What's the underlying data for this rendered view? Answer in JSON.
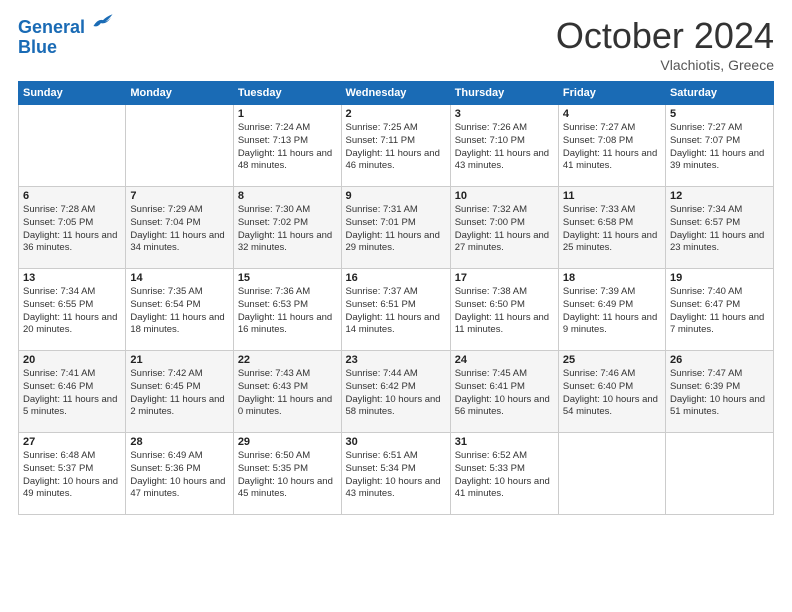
{
  "header": {
    "logo_line1": "General",
    "logo_line2": "Blue",
    "month": "October 2024",
    "location": "Vlachiotis, Greece"
  },
  "days_of_week": [
    "Sunday",
    "Monday",
    "Tuesday",
    "Wednesday",
    "Thursday",
    "Friday",
    "Saturday"
  ],
  "weeks": [
    [
      {
        "day": "",
        "info": ""
      },
      {
        "day": "",
        "info": ""
      },
      {
        "day": "1",
        "info": "Sunrise: 7:24 AM\nSunset: 7:13 PM\nDaylight: 11 hours and 48 minutes."
      },
      {
        "day": "2",
        "info": "Sunrise: 7:25 AM\nSunset: 7:11 PM\nDaylight: 11 hours and 46 minutes."
      },
      {
        "day": "3",
        "info": "Sunrise: 7:26 AM\nSunset: 7:10 PM\nDaylight: 11 hours and 43 minutes."
      },
      {
        "day": "4",
        "info": "Sunrise: 7:27 AM\nSunset: 7:08 PM\nDaylight: 11 hours and 41 minutes."
      },
      {
        "day": "5",
        "info": "Sunrise: 7:27 AM\nSunset: 7:07 PM\nDaylight: 11 hours and 39 minutes."
      }
    ],
    [
      {
        "day": "6",
        "info": "Sunrise: 7:28 AM\nSunset: 7:05 PM\nDaylight: 11 hours and 36 minutes."
      },
      {
        "day": "7",
        "info": "Sunrise: 7:29 AM\nSunset: 7:04 PM\nDaylight: 11 hours and 34 minutes."
      },
      {
        "day": "8",
        "info": "Sunrise: 7:30 AM\nSunset: 7:02 PM\nDaylight: 11 hours and 32 minutes."
      },
      {
        "day": "9",
        "info": "Sunrise: 7:31 AM\nSunset: 7:01 PM\nDaylight: 11 hours and 29 minutes."
      },
      {
        "day": "10",
        "info": "Sunrise: 7:32 AM\nSunset: 7:00 PM\nDaylight: 11 hours and 27 minutes."
      },
      {
        "day": "11",
        "info": "Sunrise: 7:33 AM\nSunset: 6:58 PM\nDaylight: 11 hours and 25 minutes."
      },
      {
        "day": "12",
        "info": "Sunrise: 7:34 AM\nSunset: 6:57 PM\nDaylight: 11 hours and 23 minutes."
      }
    ],
    [
      {
        "day": "13",
        "info": "Sunrise: 7:34 AM\nSunset: 6:55 PM\nDaylight: 11 hours and 20 minutes."
      },
      {
        "day": "14",
        "info": "Sunrise: 7:35 AM\nSunset: 6:54 PM\nDaylight: 11 hours and 18 minutes."
      },
      {
        "day": "15",
        "info": "Sunrise: 7:36 AM\nSunset: 6:53 PM\nDaylight: 11 hours and 16 minutes."
      },
      {
        "day": "16",
        "info": "Sunrise: 7:37 AM\nSunset: 6:51 PM\nDaylight: 11 hours and 14 minutes."
      },
      {
        "day": "17",
        "info": "Sunrise: 7:38 AM\nSunset: 6:50 PM\nDaylight: 11 hours and 11 minutes."
      },
      {
        "day": "18",
        "info": "Sunrise: 7:39 AM\nSunset: 6:49 PM\nDaylight: 11 hours and 9 minutes."
      },
      {
        "day": "19",
        "info": "Sunrise: 7:40 AM\nSunset: 6:47 PM\nDaylight: 11 hours and 7 minutes."
      }
    ],
    [
      {
        "day": "20",
        "info": "Sunrise: 7:41 AM\nSunset: 6:46 PM\nDaylight: 11 hours and 5 minutes."
      },
      {
        "day": "21",
        "info": "Sunrise: 7:42 AM\nSunset: 6:45 PM\nDaylight: 11 hours and 2 minutes."
      },
      {
        "day": "22",
        "info": "Sunrise: 7:43 AM\nSunset: 6:43 PM\nDaylight: 11 hours and 0 minutes."
      },
      {
        "day": "23",
        "info": "Sunrise: 7:44 AM\nSunset: 6:42 PM\nDaylight: 10 hours and 58 minutes."
      },
      {
        "day": "24",
        "info": "Sunrise: 7:45 AM\nSunset: 6:41 PM\nDaylight: 10 hours and 56 minutes."
      },
      {
        "day": "25",
        "info": "Sunrise: 7:46 AM\nSunset: 6:40 PM\nDaylight: 10 hours and 54 minutes."
      },
      {
        "day": "26",
        "info": "Sunrise: 7:47 AM\nSunset: 6:39 PM\nDaylight: 10 hours and 51 minutes."
      }
    ],
    [
      {
        "day": "27",
        "info": "Sunrise: 6:48 AM\nSunset: 5:37 PM\nDaylight: 10 hours and 49 minutes."
      },
      {
        "day": "28",
        "info": "Sunrise: 6:49 AM\nSunset: 5:36 PM\nDaylight: 10 hours and 47 minutes."
      },
      {
        "day": "29",
        "info": "Sunrise: 6:50 AM\nSunset: 5:35 PM\nDaylight: 10 hours and 45 minutes."
      },
      {
        "day": "30",
        "info": "Sunrise: 6:51 AM\nSunset: 5:34 PM\nDaylight: 10 hours and 43 minutes."
      },
      {
        "day": "31",
        "info": "Sunrise: 6:52 AM\nSunset: 5:33 PM\nDaylight: 10 hours and 41 minutes."
      },
      {
        "day": "",
        "info": ""
      },
      {
        "day": "",
        "info": ""
      }
    ]
  ]
}
